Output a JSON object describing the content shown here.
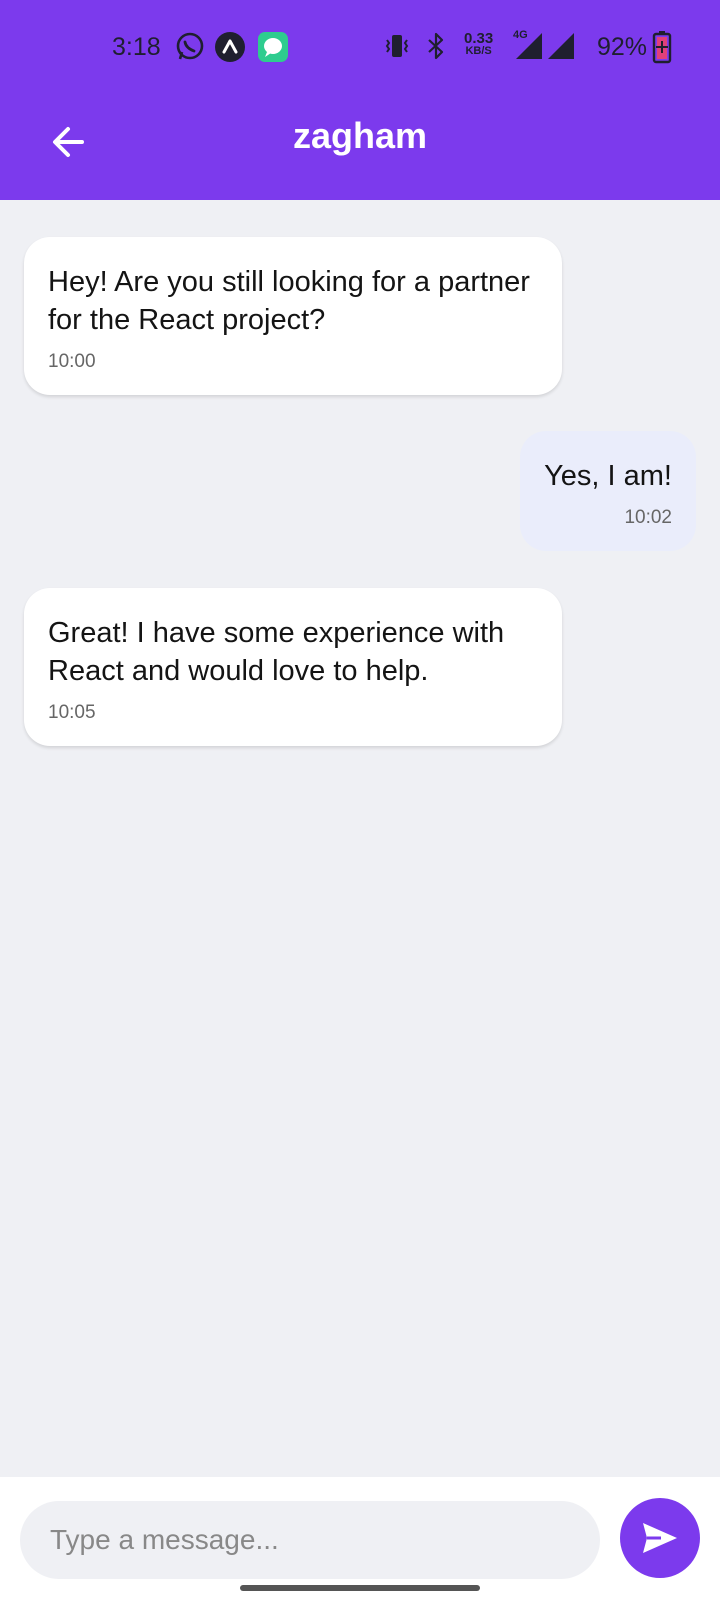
{
  "status_bar": {
    "time": "3:18",
    "net_speed": "0.33",
    "net_unit": "KB/S",
    "network_type": "4G",
    "battery": "92%"
  },
  "header": {
    "title": "zagham"
  },
  "messages": [
    {
      "direction": "incoming",
      "text": "Hey! Are you still looking for a partner for the React project?",
      "time": "10:00"
    },
    {
      "direction": "outgoing",
      "text": "Yes, I am!",
      "time": "10:02"
    },
    {
      "direction": "incoming",
      "text": "Great! I have some experience with React and would love to help.",
      "time": "10:05"
    }
  ],
  "composer": {
    "placeholder": "Type a message...",
    "value": ""
  },
  "colors": {
    "accent": "#7c3aed",
    "background": "#eff0f4",
    "incoming_bubble": "#ffffff",
    "outgoing_bubble": "#eaedfb"
  }
}
